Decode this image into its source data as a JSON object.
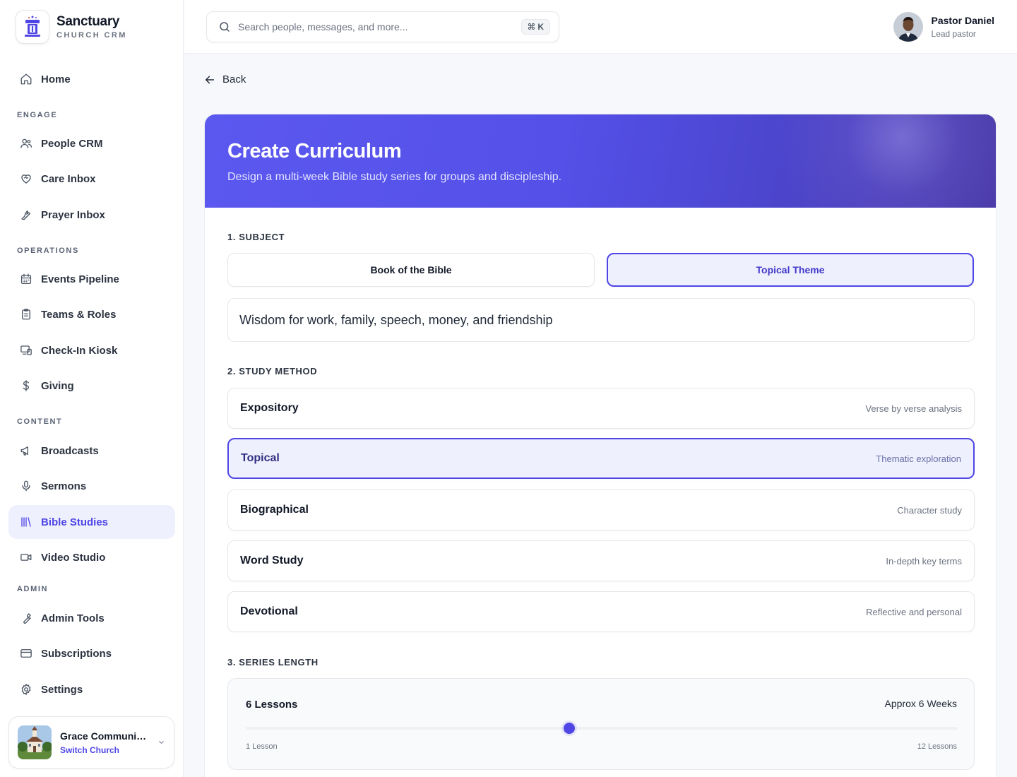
{
  "brand": {
    "name": "Sanctuary",
    "subtitle": "CHURCH CRM"
  },
  "sidebar": {
    "home": "Home",
    "sections": {
      "engage": "ENGAGE",
      "operations": "OPERATIONS",
      "content": "CONTENT",
      "admin": "ADMIN"
    },
    "items": {
      "people_crm": "People CRM",
      "care_inbox": "Care Inbox",
      "prayer_inbox": "Prayer Inbox",
      "events_pipeline": "Events Pipeline",
      "teams_roles": "Teams & Roles",
      "checkin_kiosk": "Check-In Kiosk",
      "giving": "Giving",
      "broadcasts": "Broadcasts",
      "sermons": "Sermons",
      "bible_studies": "Bible Studies",
      "video_studio": "Video Studio",
      "admin_tools": "Admin Tools",
      "subscriptions": "Subscriptions",
      "settings": "Settings"
    },
    "active": "bible_studies",
    "church": {
      "name": "Grace Community Church",
      "switch_label": "Switch Church"
    }
  },
  "header": {
    "search_placeholder": "Search people, messages, and more...",
    "shortcut": "⌘ K",
    "user": {
      "name": "Pastor Daniel",
      "role": "Lead pastor"
    }
  },
  "main": {
    "back_label": "Back",
    "title": "Create Curriculum",
    "subtitle": "Design a multi-week Bible study series for groups and discipleship.",
    "subject": {
      "label": "1. SUBJECT",
      "options": [
        "Book of the Bible",
        "Topical Theme"
      ],
      "selected": "Topical Theme",
      "theme_value": "Wisdom for work, family, speech, money, and friendship"
    },
    "study_method": {
      "label": "2. STUDY METHOD",
      "options": [
        {
          "title": "Expository",
          "desc": "Verse by verse analysis"
        },
        {
          "title": "Topical",
          "desc": "Thematic exploration"
        },
        {
          "title": "Biographical",
          "desc": "Character study"
        },
        {
          "title": "Word Study",
          "desc": "In-depth key terms"
        },
        {
          "title": "Devotional",
          "desc": "Reflective and personal"
        }
      ],
      "selected": "Topical"
    },
    "series_length": {
      "label": "3. SERIES LENGTH",
      "value_label": "6 Lessons",
      "approx_label": "Approx 6 Weeks",
      "value": 6,
      "min": 1,
      "max": 12,
      "min_label": "1 Lesson",
      "max_label": "12 Lessons"
    }
  },
  "colors": {
    "accent": "#4f46e5",
    "accent_soft": "#eef0fd",
    "hero_start": "#5b58f0",
    "hero_end": "#4a3aa8"
  }
}
